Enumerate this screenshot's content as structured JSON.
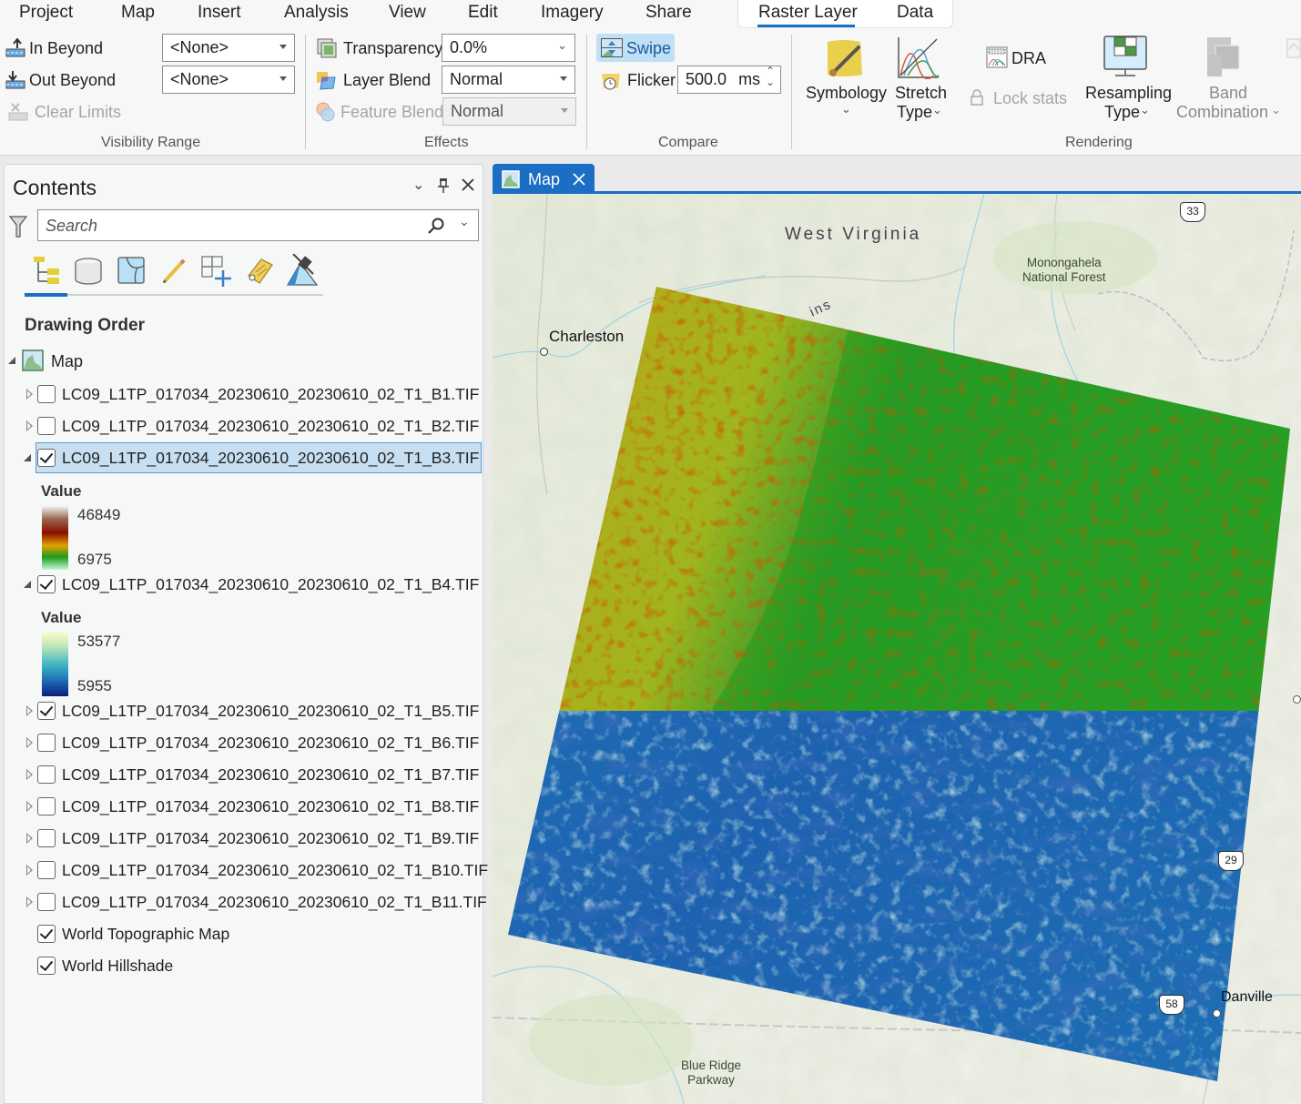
{
  "ribbon": {
    "tabs": [
      {
        "label": "Project"
      },
      {
        "label": "Map"
      },
      {
        "label": "Insert"
      },
      {
        "label": "Analysis"
      },
      {
        "label": "View"
      },
      {
        "label": "Edit"
      },
      {
        "label": "Imagery"
      },
      {
        "label": "Share"
      },
      {
        "label": "Raster Layer",
        "active": true
      },
      {
        "label": "Data"
      }
    ],
    "visibility_range": {
      "group_label": "Visibility Range",
      "in_beyond": "In Beyond",
      "out_beyond": "Out Beyond",
      "clear_limits": "Clear Limits",
      "in_beyond_value": "<None>",
      "out_beyond_value": "<None>"
    },
    "effects": {
      "group_label": "Effects",
      "transparency": "Transparency",
      "transparency_value": "0.0%",
      "layer_blend": "Layer Blend",
      "layer_blend_value": "Normal",
      "feature_blend": "Feature Blend",
      "feature_blend_value": "Normal"
    },
    "compare": {
      "group_label": "Compare",
      "swipe": "Swipe",
      "flicker": "Flicker",
      "flicker_value": "500.0",
      "flicker_unit": "ms"
    },
    "rendering": {
      "group_label": "Rendering",
      "symbology": "Symbology",
      "stretch_type_1": "Stretch",
      "stretch_type_2": "Type",
      "dra": "DRA",
      "lock_stats": "Lock stats",
      "resampling_1": "Resampling",
      "resampling_2": "Type",
      "band_combo_1": "Band",
      "band_combo_2": "Combination"
    }
  },
  "contents": {
    "title": "Contents",
    "search_placeholder": "Search",
    "section_title": "Drawing Order",
    "map_node": "Map",
    "layers": [
      {
        "name": "LC09_L1TP_017034_20230610_20230610_02_T1_B1.TIF",
        "checked": false,
        "expanded": false
      },
      {
        "name": "LC09_L1TP_017034_20230610_20230610_02_T1_B2.TIF",
        "checked": false,
        "expanded": false
      },
      {
        "name": "LC09_L1TP_017034_20230610_20230610_02_T1_B3.TIF",
        "checked": true,
        "expanded": true,
        "selected": true,
        "legend": {
          "title": "Value",
          "max": "46849",
          "min": "6975"
        }
      },
      {
        "name": "LC09_L1TP_017034_20230610_20230610_02_T1_B4.TIF",
        "checked": true,
        "expanded": true,
        "legend": {
          "title": "Value",
          "max": "53577",
          "min": "5955"
        }
      },
      {
        "name": "LC09_L1TP_017034_20230610_20230610_02_T1_B5.TIF",
        "checked": true,
        "expanded": false
      },
      {
        "name": "LC09_L1TP_017034_20230610_20230610_02_T1_B6.TIF",
        "checked": false,
        "expanded": false
      },
      {
        "name": "LC09_L1TP_017034_20230610_20230610_02_T1_B7.TIF",
        "checked": false,
        "expanded": false
      },
      {
        "name": "LC09_L1TP_017034_20230610_20230610_02_T1_B8.TIF",
        "checked": false,
        "expanded": false
      },
      {
        "name": "LC09_L1TP_017034_20230610_20230610_02_T1_B9.TIF",
        "checked": false,
        "expanded": false
      },
      {
        "name": "LC09_L1TP_017034_20230610_20230610_02_T1_B10.TIF",
        "checked": false,
        "expanded": false
      },
      {
        "name": "LC09_L1TP_017034_20230610_20230610_02_T1_B11.TIF",
        "checked": false,
        "expanded": false
      },
      {
        "name": "World Topographic Map",
        "checked": true,
        "basemap": true
      },
      {
        "name": "World Hillshade",
        "checked": true,
        "basemap": true
      }
    ]
  },
  "map": {
    "tab_label": "Map",
    "labels": {
      "west_virginia": "West Virginia",
      "charleston": "Charleston",
      "monongahela_1": "Monongahela",
      "monongahela_2": "National Forest",
      "mountains_fragment": "ins",
      "danville": "Danville",
      "blue_ridge_1": "Blue Ridge",
      "blue_ridge_2": "Parkway"
    },
    "shields": {
      "us33": "33",
      "us29": "29",
      "us58": "58"
    },
    "colors": {
      "accent": "#1a6fc4",
      "b3_ramp": [
        "#f0f0f0",
        "#8b5a3c",
        "#8b0000",
        "#e8a000",
        "#2e9a2e",
        "#c9f5c0"
      ],
      "b4_ramp": [
        "#fbfbc8",
        "#7fcdbb",
        "#1d91c0",
        "#225ea8",
        "#0c2c84"
      ]
    }
  }
}
